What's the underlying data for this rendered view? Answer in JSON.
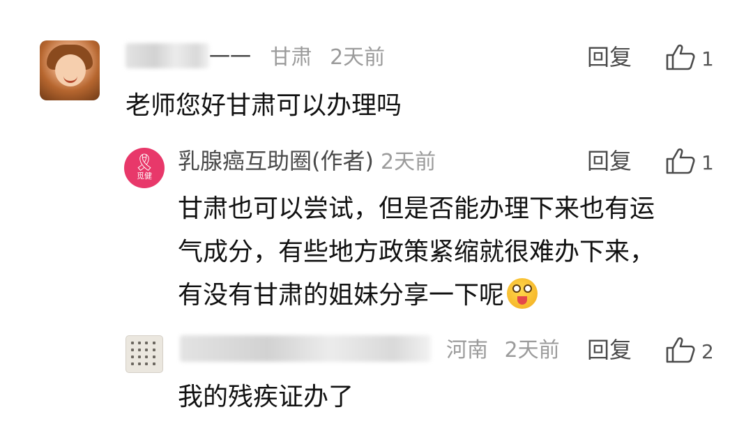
{
  "comments": [
    {
      "username": "一一",
      "location": "甘肃",
      "time": "2天前",
      "reply_label": "回复",
      "likes": "1",
      "text": "老师您好甘肃可以办理吗",
      "avatar_icon": "child-portrait-avatar"
    },
    {
      "author_name": "乳腺癌互助圈(作者)",
      "time": "2天前",
      "reply_label": "回复",
      "likes": "1",
      "avatar_brand": "觅健",
      "avatar_icon": "pink-ribbon-avatar",
      "text_lines": [
        "甘肃也可以尝试，但是否能办理下来也有运",
        "气成分，有些地方政策紧缩就很难办下来，",
        "有没有甘肃的姐妹分享一下呢"
      ],
      "emoji_icon": "surprised-tongue-emoji"
    },
    {
      "location": "河南",
      "time": "2天前",
      "reply_label": "回复",
      "likes": "2",
      "text": "我的残疾证办了",
      "avatar_icon": "calligraphy-grid-avatar"
    }
  ],
  "colors": {
    "text": "#111111",
    "meta": "#9b9b9b",
    "action": "#4a4a4a",
    "author_avatar": "#e8386a"
  }
}
